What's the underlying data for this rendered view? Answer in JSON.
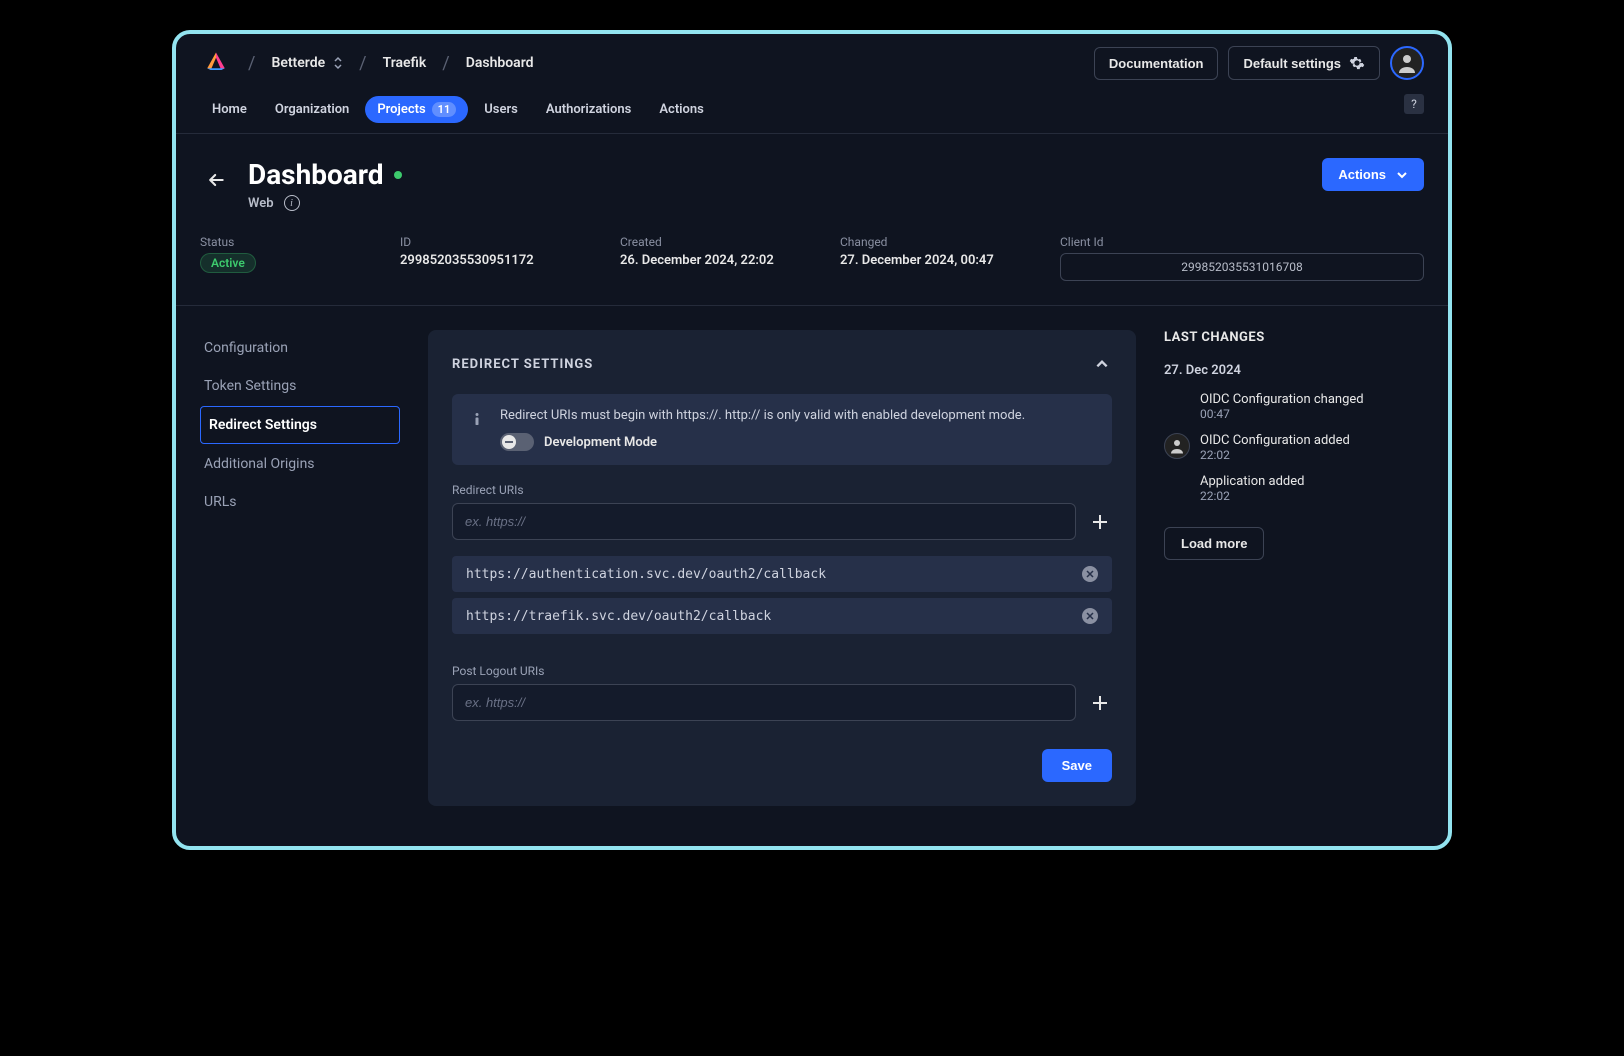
{
  "breadcrumb": {
    "org": "Betterde",
    "project": "Traefik",
    "page": "Dashboard"
  },
  "topbar": {
    "documentation": "Documentation",
    "settings": "Default settings"
  },
  "nav": {
    "home": "Home",
    "organization": "Organization",
    "projects": "Projects",
    "projects_badge": "11",
    "users": "Users",
    "authorizations": "Authorizations",
    "actions": "Actions",
    "help": "?"
  },
  "header": {
    "title": "Dashboard",
    "subtitle": "Web",
    "actions_btn": "Actions"
  },
  "meta": {
    "status_label": "Status",
    "status_value": "Active",
    "id_label": "ID",
    "id_value": "299852035530951172",
    "created_label": "Created",
    "created_value": "26. December 2024, 22:02",
    "changed_label": "Changed",
    "changed_value": "27. December 2024, 00:47",
    "clientid_label": "Client Id",
    "clientid_value": "299852035531016708"
  },
  "sidenav": {
    "configuration": "Configuration",
    "token_settings": "Token Settings",
    "redirect_settings": "Redirect Settings",
    "additional_origins": "Additional Origins",
    "urls": "URLs"
  },
  "panel": {
    "title": "REDIRECT SETTINGS",
    "banner_text": "Redirect URIs must begin with https://. http:// is only valid with enabled development mode.",
    "dev_mode_label": "Development Mode",
    "redirect_uris_label": "Redirect URIs",
    "redirect_placeholder": "ex. https://",
    "uris": [
      "https://authentication.svc.dev/oauth2/callback",
      "https://traefik.svc.dev/oauth2/callback"
    ],
    "post_logout_label": "Post Logout URIs",
    "post_logout_placeholder": "ex. https://",
    "save": "Save"
  },
  "changes": {
    "title": "LAST CHANGES",
    "date_header": "27. Dec 2024",
    "items": [
      {
        "text": "OIDC Configuration changed",
        "time": "00:47",
        "with_avatar": false
      },
      {
        "text": "OIDC Configuration added",
        "time": "22:02",
        "with_avatar": true
      },
      {
        "text": "Application added",
        "time": "22:02",
        "with_avatar": false
      }
    ],
    "load_more": "Load more"
  }
}
